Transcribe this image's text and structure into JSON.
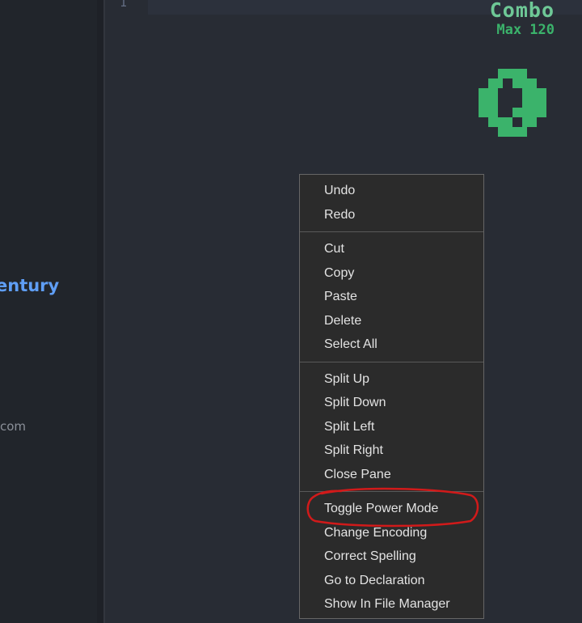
{
  "sidebar": {
    "link_text": "entury",
    "domain_text": "com"
  },
  "editor": {
    "line_number": "1"
  },
  "power_mode": {
    "combo_label": "Combo",
    "max_label": "Max 120",
    "current_count": "0",
    "color": "#3bb36b"
  },
  "context_menu": {
    "groups": [
      {
        "items": [
          "Undo",
          "Redo"
        ]
      },
      {
        "items": [
          "Cut",
          "Copy",
          "Paste",
          "Delete",
          "Select All"
        ]
      },
      {
        "items": [
          "Split Up",
          "Split Down",
          "Split Left",
          "Split Right",
          "Close Pane"
        ]
      },
      {
        "items": [
          "Toggle Power Mode",
          "Change Encoding",
          "Correct Spelling",
          "Go to Declaration",
          "Show In File Manager"
        ]
      }
    ]
  },
  "annotation": {
    "highlighted_item": "Toggle Power Mode",
    "color": "#d11a1a"
  }
}
